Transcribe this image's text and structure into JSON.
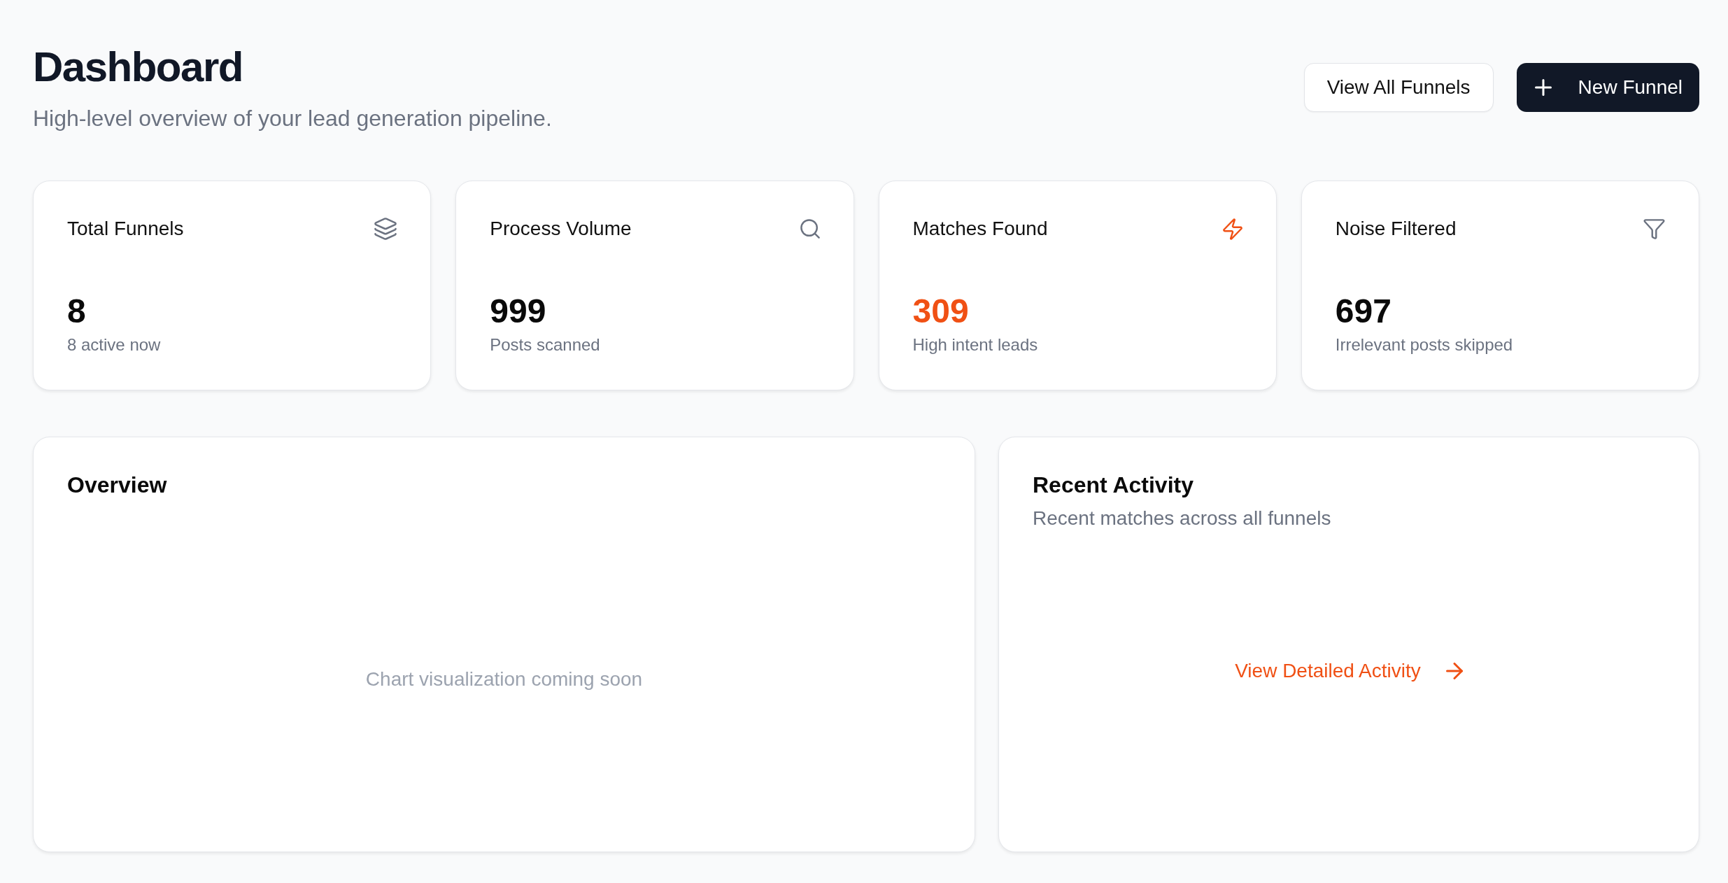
{
  "header": {
    "title": "Dashboard",
    "subtitle": "High-level overview of your lead generation pipeline."
  },
  "actions": [
    {
      "label": "View All Funnels",
      "kind": "secondary"
    },
    {
      "label": "New Funnel",
      "kind": "primary"
    }
  ],
  "stats": [
    {
      "label": "Total Funnels",
      "value": "8",
      "caption": "8 active now",
      "accent": false
    },
    {
      "label": "Process Volume",
      "value": "999",
      "caption": "Posts scanned",
      "accent": false
    },
    {
      "label": "Matches Found",
      "value": "309",
      "caption": "High intent leads",
      "accent": true
    },
    {
      "label": "Noise Filtered",
      "value": "697",
      "caption": "Irrelevant posts skipped",
      "accent": false
    }
  ],
  "overview": {
    "title": "Overview",
    "message": "Chart visualization coming soon"
  },
  "recent_activity": {
    "title": "Recent Activity",
    "subtitle": "Recent matches across all funnels",
    "link": "View Detailed Activity"
  }
}
